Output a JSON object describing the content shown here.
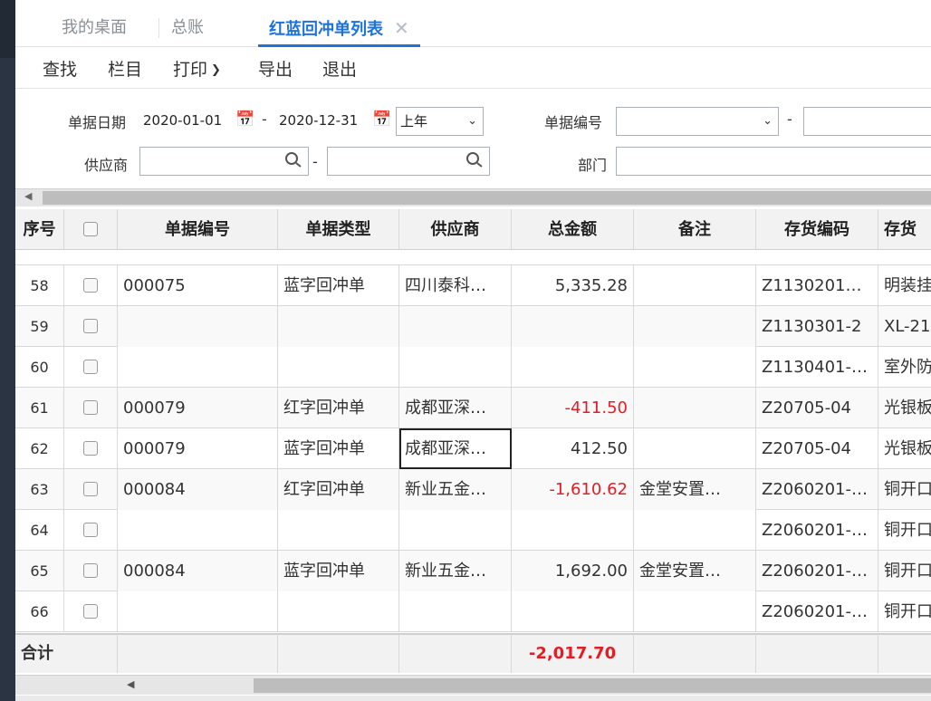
{
  "tabs": [
    {
      "label": "我的桌面"
    },
    {
      "label": "总账"
    },
    {
      "label": "红蓝回冲单列表",
      "close": "✕"
    }
  ],
  "toolbar": {
    "find": "查找",
    "columns": "栏目",
    "print": "打印",
    "export": "导出",
    "exit": "退出"
  },
  "filters": {
    "doc_date_label": "单据日期",
    "date_from": "2020-01-01",
    "date_to": "2020-12-31",
    "period": "上年",
    "doc_no_label": "单据编号",
    "supplier_label": "供应商",
    "dept_label": "部门",
    "dash": "-"
  },
  "columns": [
    "序号",
    "单据编号",
    "单据类型",
    "供应商",
    "总金额",
    "备注",
    "存货编码",
    "存货"
  ],
  "rows": [
    {
      "idx": "58",
      "doc_no": "000075",
      "type": "蓝字回冲单",
      "supplier": "四川泰科…",
      "amount": "5,335.28",
      "note": "",
      "inv_code": "Z1130201…",
      "inv": "明装挂"
    },
    {
      "idx": "59",
      "doc_no": "",
      "type": "",
      "supplier": "",
      "amount": "",
      "note": "",
      "inv_code": "Z1130301-2",
      "inv": "XL-21"
    },
    {
      "idx": "60",
      "doc_no": "",
      "type": "",
      "supplier": "",
      "amount": "",
      "note": "",
      "inv_code": "Z1130401-…",
      "inv": "室外防"
    },
    {
      "idx": "61",
      "doc_no": "000079",
      "type": "红字回冲单",
      "supplier": "成都亚深…",
      "amount": "-411.50",
      "note": "",
      "inv_code": "Z20705-04",
      "inv": "光银板"
    },
    {
      "idx": "62",
      "doc_no": "000079",
      "type": "蓝字回冲单",
      "supplier": "成都亚深…",
      "amount": "412.50",
      "note": "",
      "inv_code": "Z20705-04",
      "inv": "光银板"
    },
    {
      "idx": "63",
      "doc_no": "000084",
      "type": "红字回冲单",
      "supplier": "新业五金…",
      "amount": "-1,610.62",
      "note": "金堂安置…",
      "inv_code": "Z2060201-…",
      "inv": "铜开口"
    },
    {
      "idx": "64",
      "doc_no": "",
      "type": "",
      "supplier": "",
      "amount": "",
      "note": "",
      "inv_code": "Z2060201-…",
      "inv": "铜开口"
    },
    {
      "idx": "65",
      "doc_no": "000084",
      "type": "蓝字回冲单",
      "supplier": "新业五金…",
      "amount": "1,692.00",
      "note": "金堂安置…",
      "inv_code": "Z2060201-…",
      "inv": "铜开口"
    },
    {
      "idx": "66",
      "doc_no": "",
      "type": "",
      "supplier": "",
      "amount": "",
      "note": "",
      "inv_code": "Z2060201-…",
      "inv": "铜开口"
    }
  ],
  "total": {
    "label": "合计",
    "amount": "-2,017.70"
  },
  "colors": {
    "accent": "#1e73d9",
    "negative": "#e51c23"
  }
}
